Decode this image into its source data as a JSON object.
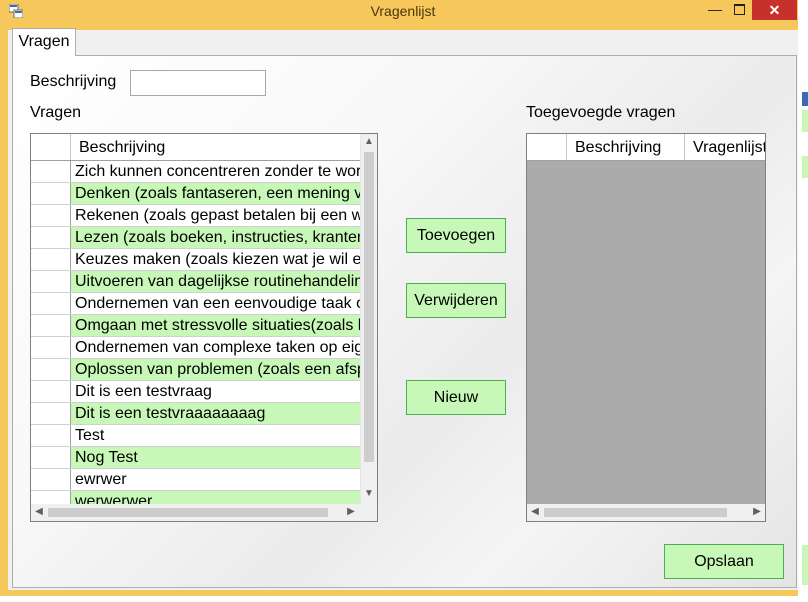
{
  "window": {
    "title": "Vragenlijst",
    "minimize_glyph": "—",
    "close_glyph": "✕"
  },
  "tabs": [
    {
      "label": "Vragen",
      "selected": true
    }
  ],
  "form": {
    "beschrijving_label": "Beschrijving",
    "beschrijving_value": "",
    "vragen_label": "Vragen",
    "toegevoegde_label": "Toegevoegde vragen"
  },
  "left_grid": {
    "columns": [
      "Beschrijving"
    ],
    "rows": [
      "Zich kunnen concentreren zonder te worden",
      "Denken (zoals fantaseren, een mening vormen)",
      "Rekenen (zoals gepast betalen bij een winkel)",
      "Lezen (zoals boeken, instructies, kranten)",
      "Keuzes maken (zoals kiezen wat je wil eten)",
      "Uitvoeren van dagelijkse routinehandelingen",
      "Ondernemen van een eenvoudige taak of",
      "Omgaan met stressvolle situaties(zoals het",
      "Ondernemen van complexe taken op eigen",
      "Oplossen van problemen (zoals een afspraak",
      "Dit is een testvraag",
      "Dit is een testvraaaaaaaag",
      "Test",
      "Nog Test",
      "ewrwer",
      "werwerwer"
    ],
    "alt_color": "#c7f8b7"
  },
  "right_grid": {
    "columns": [
      "Beschrijving",
      "Vragenlijst"
    ],
    "rows": []
  },
  "buttons": {
    "toevoegen": "Toevoegen",
    "verwijderen": "Verwijderen",
    "nieuw": "Nieuw",
    "opslaan": "Opslaan"
  },
  "colors": {
    "title_bar": "#f6c75a",
    "close_button": "#c8302b",
    "button_fill": "#c7f8b7",
    "button_border": "#4caf50",
    "empty_grid": "#ababab"
  }
}
